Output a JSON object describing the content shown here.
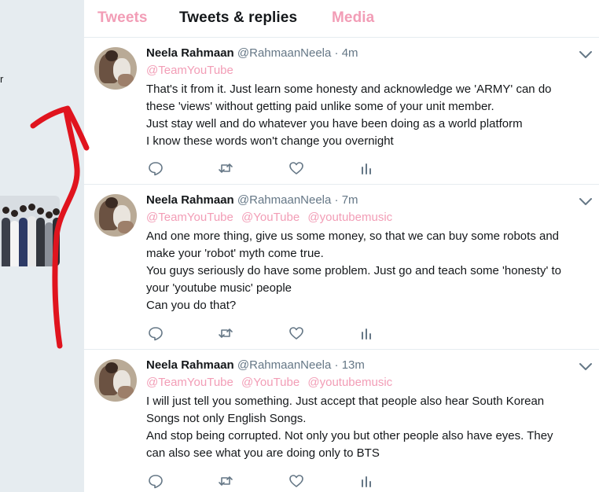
{
  "left": {
    "stray_char": "r",
    "thumb_image": "group-photo"
  },
  "tabs": [
    {
      "label": "Tweets"
    },
    {
      "label": "Tweets & replies"
    },
    {
      "label": "Media"
    }
  ],
  "tweets": [
    {
      "name": "Neela Rahmaan",
      "handle": "@RahmaanNeela",
      "separator": "·",
      "time": "4m",
      "mentions": [
        "@TeamYouTube"
      ],
      "lines": [
        "That's it from it. Just learn some honesty and acknowledge we 'ARMY' can do",
        "these 'views' without getting paid unlike some of your unit member.",
        "Just stay well and do whatever you have been doing as a world platform",
        "I know these words won't change you overnight"
      ]
    },
    {
      "name": "Neela Rahmaan",
      "handle": "@RahmaanNeela",
      "separator": "·",
      "time": "7m",
      "mentions": [
        "@TeamYouTube",
        "@YouTube",
        "@youtubemusic"
      ],
      "lines": [
        "And one more thing, give us some money, so that we can buy some robots and",
        "make your 'robot' myth come true.",
        "You guys seriously do have some problem. Just go and teach some 'honesty' to",
        "your 'youtube music' people",
        "Can you do that?"
      ]
    },
    {
      "name": "Neela Rahmaan",
      "handle": "@RahmaanNeela",
      "separator": "·",
      "time": "13m",
      "mentions": [
        "@TeamYouTube",
        "@YouTube",
        "@youtubemusic"
      ],
      "lines": [
        "I will just tell you something. Just accept that people also hear South Korean",
        "Songs not only English Songs.",
        "And stop being corrupted. Not only you but other people also have eyes. They",
        "can also see what you are doing only to BTS"
      ]
    }
  ],
  "icons": {
    "reply": "reply-icon",
    "retweet": "retweet-icon",
    "like": "heart-icon",
    "analytics": "analytics-icon",
    "more": "chevron-down-icon"
  },
  "colors": {
    "accent_pink": "#f29db6",
    "text": "#14171a",
    "muted": "#657786",
    "annotation_red": "#e0141e"
  }
}
